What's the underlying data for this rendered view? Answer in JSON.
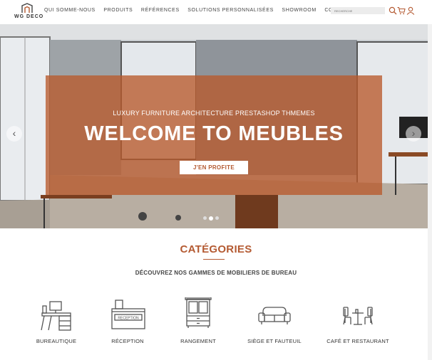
{
  "header": {
    "logo_text": "WG DECO",
    "nav": [
      {
        "label": "QUI SOMME-NOUS"
      },
      {
        "label": "PRODUITS"
      },
      {
        "label": "RÉFÉRENCES"
      },
      {
        "label": "SOLUTIONS PERSONNALISÉES"
      },
      {
        "label": "SHOWROOM"
      },
      {
        "label": "CONTACT"
      }
    ],
    "search_placeholder": "RECHERCHE",
    "icons": [
      "search-icon",
      "cart-icon",
      "user-icon"
    ]
  },
  "hero": {
    "subtitle": "LUXURY FURNITURE ARCHITECTURE PRESTASHOP THMEMES",
    "title": "WELCOME TO MEUBLES",
    "cta_label": "J'EN PROFITE",
    "prev_arrow": "‹",
    "next_arrow": "›",
    "slides": 3,
    "active_slide": 2,
    "overlay_color": "#b85a2c"
  },
  "categories": {
    "title": "CATÉGORIES",
    "subtitle": "DÉCOUVREZ NOS GAMMES DE MOBILIERS DE BUREAU",
    "items": [
      {
        "label": "BUREAUTIQUE",
        "icon": "desk-icon"
      },
      {
        "label": "RÉCEPTION",
        "icon": "reception-desk-icon",
        "icon_text": "RECEPTION"
      },
      {
        "label": "RANGEMENT",
        "icon": "cabinet-icon"
      },
      {
        "label": "SIÈGE ET FAUTEUIL",
        "icon": "sofa-icon"
      },
      {
        "label": "CAFÉ ET RESTAURANT",
        "icon": "cafe-table-icon"
      }
    ]
  },
  "colors": {
    "accent": "#b45a32",
    "text": "#333333"
  }
}
